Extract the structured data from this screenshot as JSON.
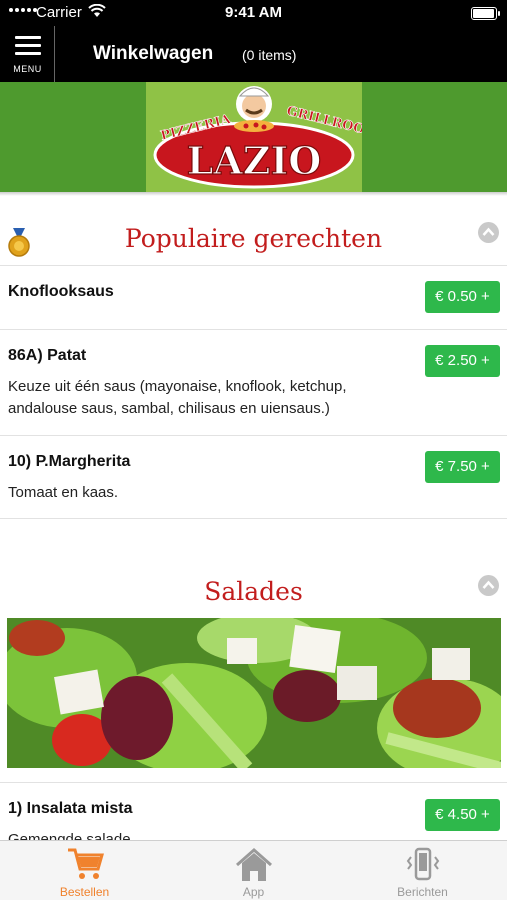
{
  "status_bar": {
    "carrier": "Carrier",
    "time": "9:41 AM",
    "battery_level": 1.0
  },
  "header": {
    "menu_label": "MENU",
    "title": "Winkelwagen",
    "item_count": "(0 items)"
  },
  "banner": {
    "logo_top_left": "PIZZERIA",
    "logo_top_right": "GRILLROOM",
    "logo_name": "LAZIO"
  },
  "sections": [
    {
      "title": "Populaire gerechten",
      "icon": "medal-icon",
      "items": [
        {
          "name": "Knoflooksaus",
          "description": "",
          "price": "€ 0.50 +"
        },
        {
          "name": "86A)  Patat",
          "description": "Keuze uit één saus (mayonaise, knoflook, ketchup, andalouse saus, sambal, chilisaus en uiensaus.)",
          "price": "€ 2.50 +"
        },
        {
          "name": "10)  P.Margherita",
          "description": "Tomaat en kaas.",
          "price": "€ 7.50 +"
        }
      ]
    },
    {
      "title": "Salades",
      "image": "salad-photo",
      "items": [
        {
          "name": "1)  Insalata mista",
          "description": "Gemengde salade",
          "price": "€ 4.50 +"
        }
      ]
    }
  ],
  "tabs": [
    {
      "label": "Bestellen",
      "icon": "cart-icon",
      "active": true
    },
    {
      "label": "App",
      "icon": "home-icon",
      "active": false
    },
    {
      "label": "Berichten",
      "icon": "phone-vibrate-icon",
      "active": false
    }
  ],
  "colors": {
    "accent_green": "#2eb84b",
    "title_red": "#c21d1d",
    "active_tab": "#f0822d",
    "banner_green": "#4e9a2e"
  }
}
